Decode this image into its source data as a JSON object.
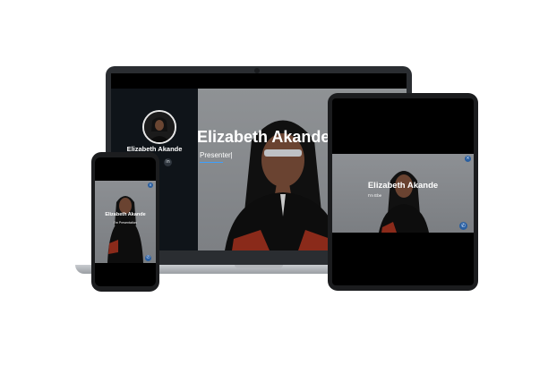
{
  "laptop": {
    "profile_name": "Elizabeth Akande",
    "social_icons": [
      "twitter-icon",
      "facebook-icon",
      "instagram-icon",
      "linkedin-icon"
    ],
    "social_glyphs": [
      "t",
      "f",
      "◎",
      "in"
    ],
    "hero_title": "Elizabeth Akande",
    "hero_subtitle": "Presenter|"
  },
  "tablet": {
    "hero_title": "Elizabeth Akande",
    "hero_subtitle": "I'm Ebe"
  },
  "phone": {
    "hero_title": "Elizabeth Akande",
    "hero_subtitle": "I'm Presentation"
  },
  "colors": {
    "sidebar_bg": "#0f1419",
    "hero_bg": "#8f9295",
    "accent": "#2a5fa0",
    "text": "#ffffff"
  }
}
